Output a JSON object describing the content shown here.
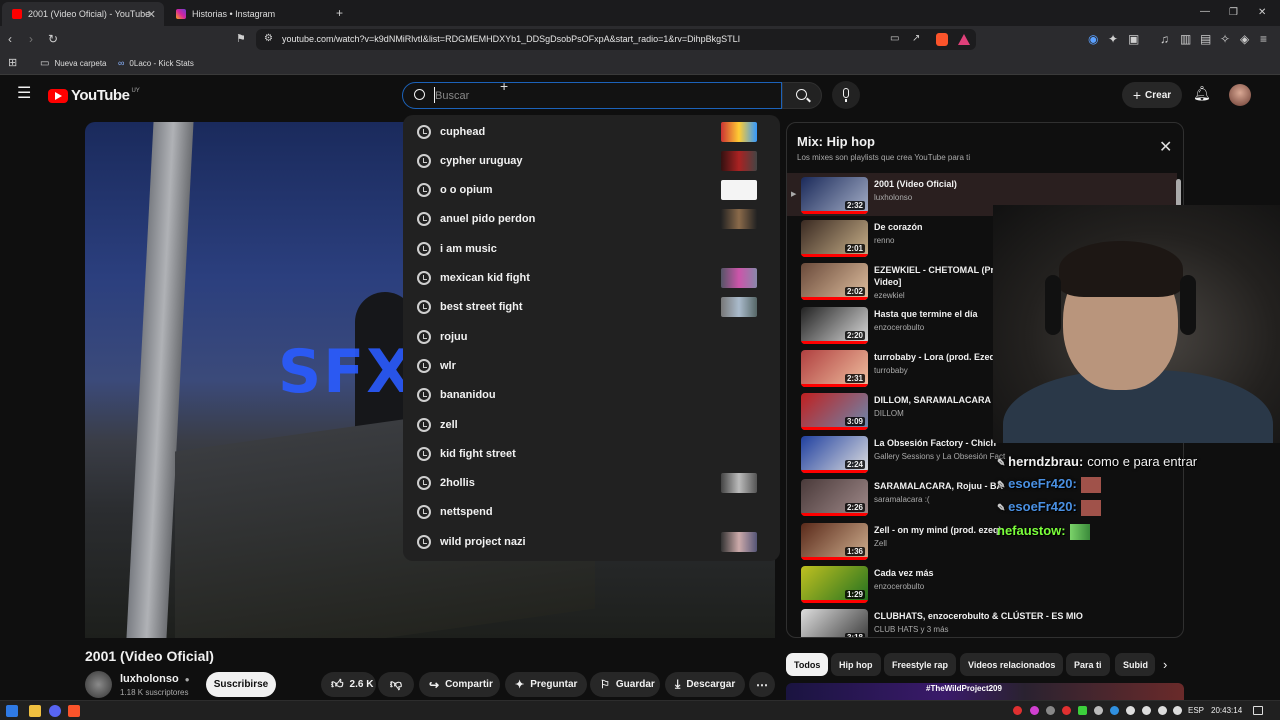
{
  "browser": {
    "tabs": [
      {
        "title": "2001 (Video Oficial) - YouTube",
        "close": "✕"
      },
      {
        "title": "Historias • Instagram"
      }
    ],
    "new_tab": "+",
    "url": "youtube.com/watch?v=k9dNMiRlvtI&list=RDGMEMHDXYb1_DDSgDsobPsOFxpA&start_radio=1&rv=DihpBkgSTLI",
    "bookmarks": [
      "Nueva carpeta",
      "0Laco - Kick Stats"
    ],
    "window_controls": [
      "—",
      "❐",
      "✕"
    ]
  },
  "youtube": {
    "logo_text": "YouTube",
    "region": "UY",
    "search_placeholder": "Buscar",
    "create_label": "Crear",
    "suggestions": [
      {
        "text": "cuphead",
        "thumb": true
      },
      {
        "text": "cypher uruguay",
        "thumb": true
      },
      {
        "text": "o o opium",
        "thumb": true
      },
      {
        "text": "anuel pido perdon",
        "thumb": true
      },
      {
        "text": "i am music",
        "thumb": false
      },
      {
        "text": "mexican kid fight",
        "thumb": true
      },
      {
        "text": "best street fight",
        "thumb": true
      },
      {
        "text": "rojuu",
        "thumb": false
      },
      {
        "text": "wlr",
        "thumb": false
      },
      {
        "text": "bananidou",
        "thumb": false
      },
      {
        "text": "zell",
        "thumb": false
      },
      {
        "text": "kid fight street",
        "thumb": false
      },
      {
        "text": "2hollis",
        "thumb": true
      },
      {
        "text": "nettspend",
        "thumb": false
      },
      {
        "text": "wild project nazi",
        "thumb": true
      }
    ],
    "video_overlay_text": "SFX",
    "video_title": "2001 (Video Oficial)",
    "channel": "luxholonso",
    "subscribers": "1.18 K suscriptores",
    "subscribe_label": "Suscribirse",
    "likes": "2.6 K",
    "actions": {
      "share": "Compartir",
      "ask": "Preguntar",
      "save": "Guardar",
      "download": "Descargar"
    },
    "mix": {
      "title": "Mix: Hip hop",
      "subtitle": "Los mixes son playlists que crea YouTube para ti",
      "items": [
        {
          "title": "2001 (Video Oficial)",
          "channel": "luxholonso",
          "duration": "2:32",
          "now": true
        },
        {
          "title": "De corazón",
          "channel": "renno",
          "duration": "2:01"
        },
        {
          "title": "EZEWKIEL - CHETOMAL (Pro",
          "title2": "Video]",
          "channel": "ezewkiel",
          "duration": "2:02"
        },
        {
          "title": "Hasta que termine el día",
          "channel": "enzocerobulto",
          "duration": "2:20"
        },
        {
          "title": "turrobaby - Lora (prod. Ezeq)",
          "channel": "turrobaby",
          "duration": "2:31"
        },
        {
          "title": "DILLOM, SARAMALACARA -",
          "channel": "DILLOM",
          "duration": "3:09"
        },
        {
          "title": "La Obsesión Factory - Chich",
          "channel": "Gallery Sessions y La Obsesión Fact",
          "duration": "2:24"
        },
        {
          "title": "SARAMALACARA, Rojuu - BA",
          "channel": "saramalacara :(",
          "duration": "2:26"
        },
        {
          "title": "Zell - on my mind (prod. ezeq)",
          "channel": "Zell",
          "duration": "1:36"
        },
        {
          "title": "Cada vez más",
          "channel": "enzocerobulto",
          "duration": "1:29"
        },
        {
          "title": "CLUBHATS, enzocerobulto & CLÚSTER - ES MIO",
          "channel": "CLUB HATS y 3 más",
          "duration": "3:18"
        }
      ]
    },
    "chips": [
      "Todos",
      "Hip hop",
      "Freestyle rap",
      "Videos relacionados",
      "Para ti",
      "Subid"
    ],
    "bottom_thumb_text": "#TheWildProject209"
  },
  "chat": [
    {
      "user": "herndzbrau:",
      "msg": "como e para entrar",
      "color": "#f1f1f1"
    },
    {
      "user": "esoeFr420:",
      "msg": "",
      "color": "#4a90e2"
    },
    {
      "user": "esoeFr420:",
      "msg": "",
      "color": "#4a90e2"
    },
    {
      "user": "nefaustow:",
      "msg": "",
      "color": "#7bff3b"
    }
  ],
  "taskbar": {
    "lang": "ESP",
    "time": "20:43:14"
  },
  "colors": {
    "accent": "#1c62b9",
    "progress": "#ff0000",
    "bg": "#0f0f0f"
  }
}
